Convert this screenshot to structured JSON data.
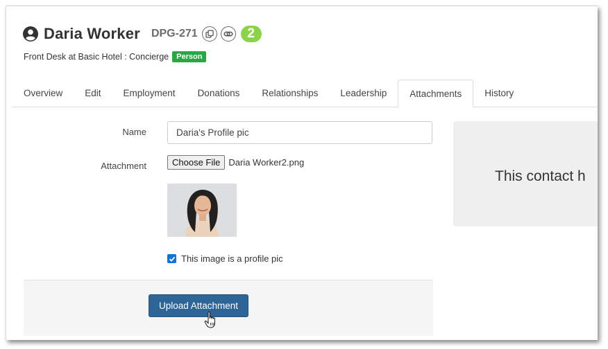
{
  "header": {
    "name": "Daria Worker",
    "code": "DPG-271",
    "count": "2",
    "count_color": "#8cd24a",
    "icons": [
      "user-circle-icon",
      "copy-icon",
      "link-icon"
    ]
  },
  "subline": {
    "text": "Front Desk at Basic Hotel : Concierge",
    "badge": "Person",
    "badge_color": "#28a745"
  },
  "tabs": [
    {
      "label": "Overview"
    },
    {
      "label": "Edit"
    },
    {
      "label": "Employment"
    },
    {
      "label": "Donations"
    },
    {
      "label": "Relationships"
    },
    {
      "label": "Leadership"
    },
    {
      "label": "Attachments",
      "active": true
    },
    {
      "label": "History"
    }
  ],
  "form": {
    "name_label": "Name",
    "name_value": "Daria's Profile pic",
    "attachment_label": "Attachment",
    "choose_file_label": "Choose File",
    "file_name": "Daria Worker2.png",
    "profile_checkbox_label": "This image is a profile pic",
    "profile_checked": true,
    "upload_label": "Upload Attachment",
    "upload_color": "#2d6596"
  },
  "info_panel": {
    "text": "This contact h"
  }
}
